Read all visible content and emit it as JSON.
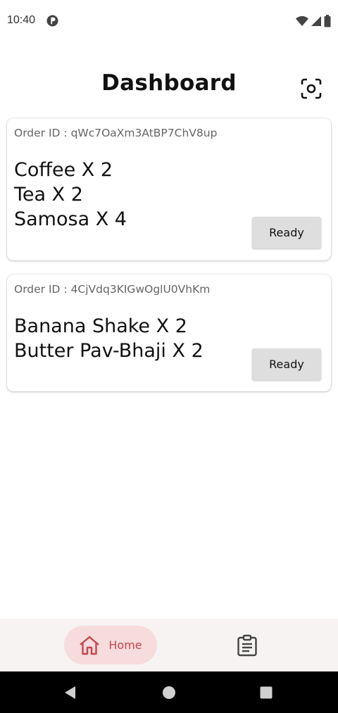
{
  "status_bar": {
    "time": "10:40"
  },
  "header": {
    "title": "Dashboard"
  },
  "orders": [
    {
      "id_label": "Order ID : ",
      "id": "qWc7OaXm3AtBP7ChV8up",
      "items": [
        "Coffee X 2",
        "Tea X 2",
        "Samosa X 4"
      ],
      "action_label": "Ready"
    },
    {
      "id_label": "Order ID : ",
      "id": "4CjVdq3KIGwOglU0VhKm",
      "items": [
        "Banana Shake X 2",
        "Butter Pav-Bhaji X 2"
      ],
      "action_label": "Ready"
    }
  ],
  "bottom_nav": {
    "home_label": "Home",
    "home_icon": "home-icon",
    "orders_icon": "clipboard-list-icon"
  },
  "colors": {
    "accent": "#c4464e",
    "nav_pill": "#f6dcdc",
    "button_bg": "#dedede",
    "nav_bg": "#f7f3f3"
  }
}
